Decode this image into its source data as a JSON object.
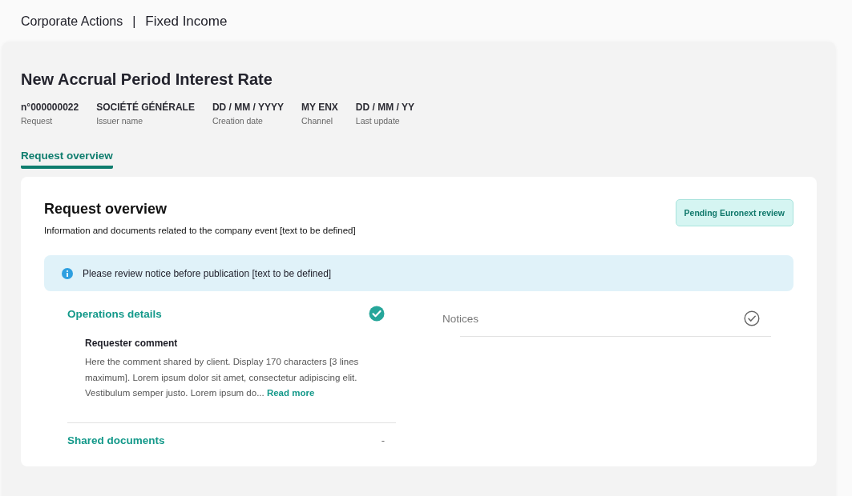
{
  "breadcrumb": {
    "items": [
      "Corporate Actions",
      "Fixed Income"
    ],
    "separator": "|"
  },
  "request": {
    "title": "New Accrual Period Interest Rate",
    "meta": [
      {
        "value": "n°000000022",
        "label": "Request"
      },
      {
        "value": "SOCIÉTÉ GÉNÉRALE",
        "label": "Issuer name"
      },
      {
        "value": "DD / MM / YYYY",
        "label": "Creation date"
      },
      {
        "value": "MY ENX",
        "label": "Channel"
      },
      {
        "value": "DD / MM / YY",
        "label": "Last update"
      }
    ]
  },
  "tabs": [
    {
      "label": "Request overview",
      "selected": true
    }
  ],
  "overview": {
    "title": "Request overview",
    "subtitle": "Information and documents related to the company event [text to be defined]",
    "status_badge": "Pending Euronext review",
    "alert": {
      "text": "Please review notice before publication [text to be defined]"
    },
    "operations": {
      "title": "Operations details",
      "completed": true,
      "comment_title": "Requester comment",
      "comment_text": "Here the comment shared by client. Display 170 characters [3 lines maximum]. Lorem ipsum dolor sit amet, consectetur adipiscing elit. Vestibulum semper justo. Lorem ipsum do... ",
      "comment_link": "Read more"
    },
    "shared_documents": {
      "title": "Shared documents",
      "value": "-"
    },
    "notices": {
      "title": "Notices",
      "completed": false
    }
  }
}
